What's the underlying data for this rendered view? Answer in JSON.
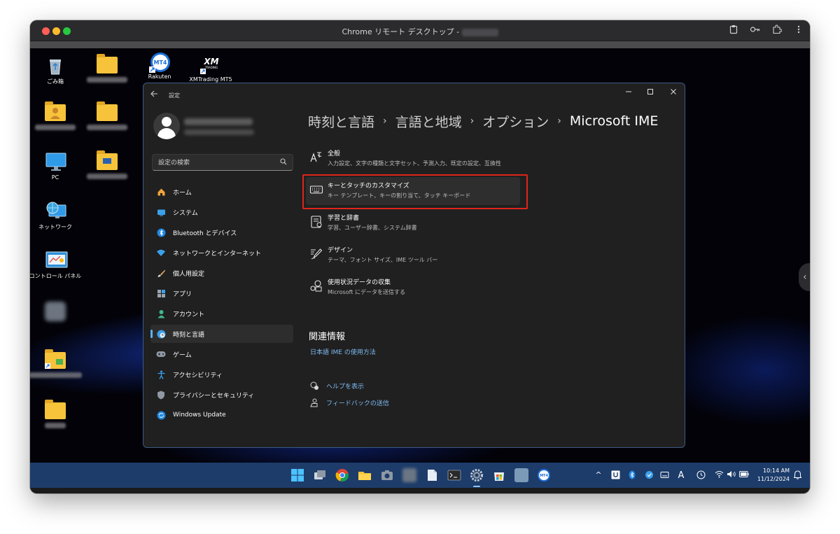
{
  "mac_window": {
    "title": "Chrome リモート デスクトップ -"
  },
  "desktop": {
    "icons": [
      {
        "label": "ごみ箱",
        "icon": "recycle-bin-icon"
      },
      {
        "label": "Rakuten",
        "icon": "mt4-shortcut-icon"
      },
      {
        "label": "XMTrading MT5",
        "icon": "xm-trading-shortcut-icon"
      },
      {
        "label": "PC",
        "icon": "pc-icon"
      },
      {
        "label": "ネットワーク",
        "icon": "network-icon"
      },
      {
        "label": "コントロール パネル",
        "icon": "control-panel-icon"
      }
    ]
  },
  "settings": {
    "app_title": "設定",
    "search": {
      "placeholder": "設定の検索"
    },
    "nav": [
      {
        "label": "ホーム",
        "icon": "home-icon",
        "active": false
      },
      {
        "label": "システム",
        "icon": "system-icon",
        "active": false
      },
      {
        "label": "Bluetooth とデバイス",
        "icon": "bluetooth-icon",
        "active": false
      },
      {
        "label": "ネットワークとインターネット",
        "icon": "wifi-icon",
        "active": false
      },
      {
        "label": "個人用設定",
        "icon": "brush-icon",
        "active": false
      },
      {
        "label": "アプリ",
        "icon": "apps-icon",
        "active": false
      },
      {
        "label": "アカウント",
        "icon": "account-icon",
        "active": false
      },
      {
        "label": "時刻と言語",
        "icon": "globe-clock-icon",
        "active": true
      },
      {
        "label": "ゲーム",
        "icon": "gamepad-icon",
        "active": false
      },
      {
        "label": "アクセシビリティ",
        "icon": "accessibility-icon",
        "active": false
      },
      {
        "label": "プライバシーとセキュリティ",
        "icon": "shield-icon",
        "active": false
      },
      {
        "label": "Windows Update",
        "icon": "update-icon",
        "active": false
      }
    ],
    "breadcrumb": [
      "時刻と言語",
      "言語と地域",
      "オプション",
      "Microsoft IME"
    ],
    "breadcrumb_sep": "›",
    "options": [
      {
        "title": "全般",
        "desc": "入力設定、文字の種類と文字セット、予測入力、既定の設定、互換性",
        "icon": "general-text-icon"
      },
      {
        "title": "キーとタッチのカスタマイズ",
        "desc": "キー テンプレート、キーの割り当て、タッチ キーボード",
        "icon": "keyboard-icon",
        "highlighted": true
      },
      {
        "title": "学習と辞書",
        "desc": "学習、ユーザー辞書、システム辞書",
        "icon": "dictionary-icon"
      },
      {
        "title": "デザイン",
        "desc": "テーマ、フォント サイズ、IME ツール バー",
        "icon": "design-pen-icon"
      },
      {
        "title": "使用状況データの収集",
        "desc": "Microsoft にデータを送信する",
        "icon": "data-collection-icon"
      }
    ],
    "related": {
      "heading": "関連情報",
      "link": "日本語 IME の使用方法"
    },
    "help": [
      {
        "label": "ヘルプを表示",
        "icon": "help-chat-icon"
      },
      {
        "label": "フィードバックの送信",
        "icon": "feedback-icon"
      }
    ]
  },
  "taskbar": {
    "apps": [
      "windows-start-icon",
      "task-view-icon",
      "chrome-icon",
      "file-explorer-icon",
      "camera-icon",
      "blurred-app-icon",
      "notepad-icon",
      "terminal-icon",
      "settings-gear-icon",
      "store-icon",
      "blurred-app-icon",
      "mt4-icon"
    ],
    "tray": {
      "ime_mode": "A",
      "time": "10:14 AM",
      "date": "11/12/2024"
    }
  },
  "colors": {
    "accent": "#5ab4f0",
    "link": "#7dbbf2",
    "highlight_border": "#e0241b",
    "settings_bg": "#202020",
    "taskbar_bg": "#1d3c6a"
  }
}
